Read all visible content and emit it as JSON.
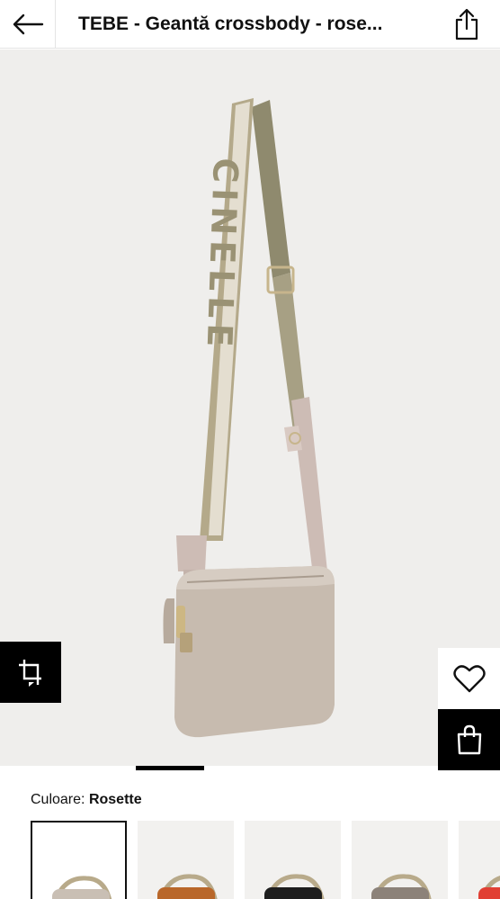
{
  "header": {
    "title": "TEBE - Geantă crossbody - rose...",
    "back_icon": "arrow-left-icon",
    "share_icon": "share-icon"
  },
  "hero": {
    "image": "product-photo-crossbody-bag",
    "strap_text": "COCCINELLE"
  },
  "actions": {
    "fullscreen_icon": "expand-icon",
    "wishlist_icon": "heart-icon",
    "cart_icon": "shopping-bag-icon"
  },
  "gallery": {
    "current_fraction": 0.25
  },
  "color": {
    "label": "Culoare:",
    "value": "Rosette"
  },
  "swatches": [
    {
      "name": "Rosette",
      "color": "#c9bfb4",
      "selected": true
    },
    {
      "name": "Brown",
      "color": "#b9672a",
      "selected": false
    },
    {
      "name": "Black",
      "color": "#1e1e1e",
      "selected": false
    },
    {
      "name": "Taupe",
      "color": "#8c8279",
      "selected": false
    },
    {
      "name": "Red",
      "color": "#e14034",
      "selected": false
    }
  ]
}
